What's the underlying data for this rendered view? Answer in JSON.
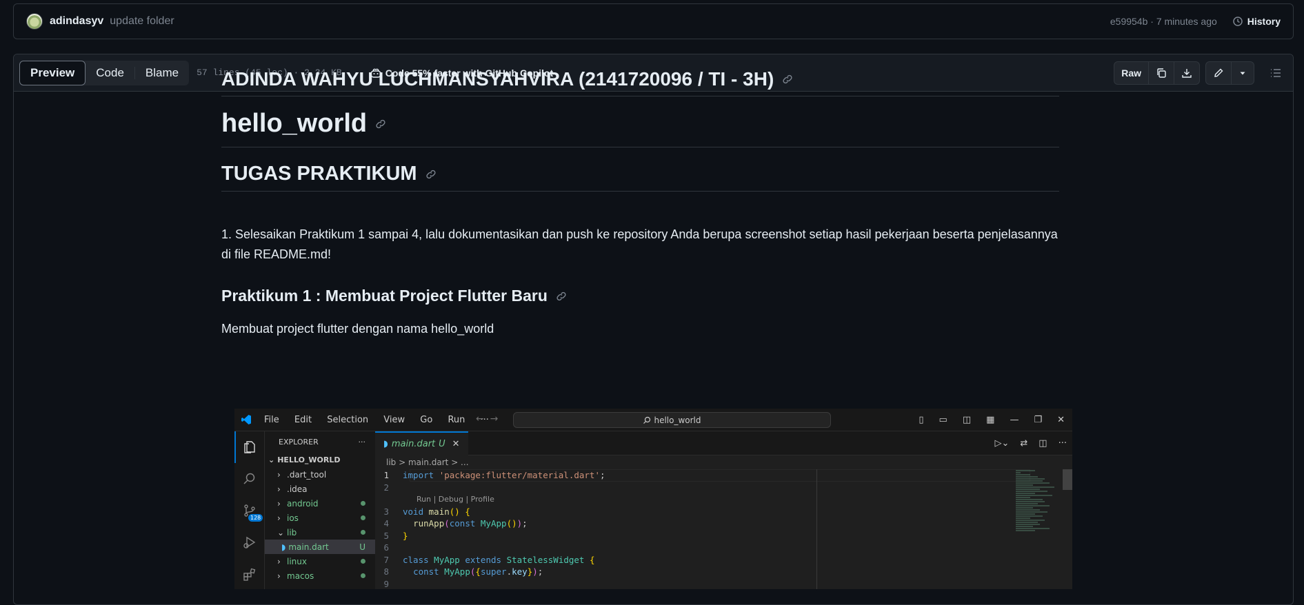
{
  "commit": {
    "author": "adindasyv",
    "message": "update folder",
    "hash_time": "e59954b · 7 minutes ago",
    "history_label": "History"
  },
  "toolbar": {
    "tabs": [
      "Preview",
      "Code",
      "Blame"
    ],
    "meta": "57 lines (45 loc) · 2.34 KB",
    "copilot": "Code 55% faster with GitHub Copilot",
    "raw_label": "Raw"
  },
  "readme": {
    "title1": "ADINDA WAHYU LUCHMANSYAHVIRA (2141720096 / TI - 3H)",
    "title2": "hello_world",
    "title3": "TUGAS PRAKTIKUM",
    "paragraph1": "1. Selesaikan Praktikum 1 sampai 4, lalu dokumentasikan dan push ke repository Anda berupa screenshot setiap hasil pekerjaan beserta penjelasannya di file README.md!",
    "heading_prak1": "Praktikum 1 : Membuat Project Flutter Baru",
    "paragraph2": "Membuat project flutter dengan nama hello_world"
  },
  "vscode": {
    "menu": [
      "File",
      "Edit",
      "Selection",
      "View",
      "Go",
      "Run",
      "···"
    ],
    "search": "hello_world",
    "explorer_title": "EXPLORER",
    "root": "HELLO_WORLD",
    "files": [
      ".dart_tool",
      ".idea",
      "android",
      "ios",
      "lib",
      "main.dart",
      "linux",
      "macos"
    ],
    "file_status": "U",
    "scm_badge": "128",
    "tab": "main.dart",
    "tab_status": "U",
    "breadcrumb": "lib > main.dart > ...",
    "codelens": "Run | Debug | Profile",
    "line_numbers": [
      "1",
      "2",
      "3",
      "4",
      "5",
      "6",
      "7",
      "8",
      "9"
    ]
  }
}
